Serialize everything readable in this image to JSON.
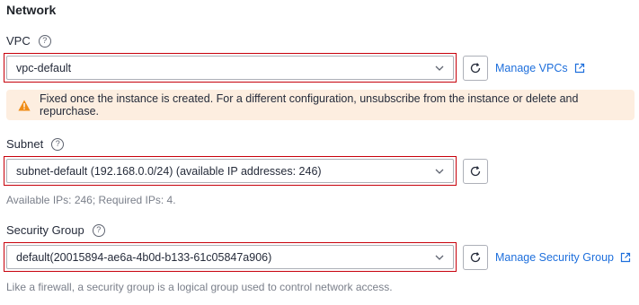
{
  "section": {
    "title": "Network"
  },
  "vpc": {
    "label": "VPC",
    "value": "vpc-default",
    "link": "Manage VPCs"
  },
  "warning": {
    "text": "Fixed once the instance is created. For a different configuration, unsubscribe from the instance or delete and repurchase."
  },
  "subnet": {
    "label": "Subnet",
    "value": "subnet-default (192.168.0.0/24) (available IP addresses: 246)",
    "hint": "Available IPs: 246; Required IPs: 4."
  },
  "security_group": {
    "label": "Security Group",
    "value": "default(20015894-ae6a-4b0d-b133-61c05847a906)",
    "link": "Manage Security Group",
    "hint": "Like a firewall, a security group is a logical group used to control network access."
  },
  "icons": {
    "help": "question-circle-icon",
    "chevron": "chevron-down-icon",
    "refresh": "refresh-icon",
    "external": "external-link-icon",
    "warning": "warning-triangle-icon"
  },
  "colors": {
    "accent_link": "#1e6fdc",
    "highlight_border": "#c7000b",
    "warning_bg": "#fdeee0",
    "warning_icon": "#f08c16"
  }
}
